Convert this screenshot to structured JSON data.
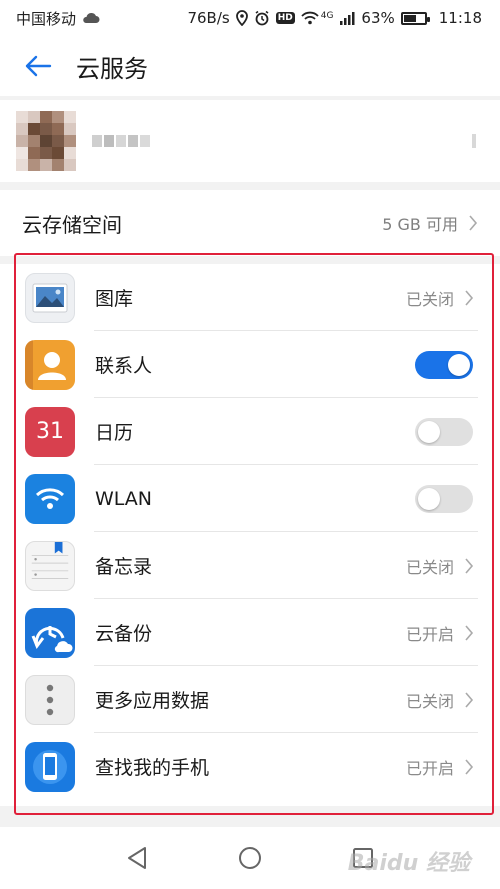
{
  "status_bar": {
    "carrier": "中国移动",
    "speed": "76B/s",
    "hd": "HD",
    "network": "4G",
    "battery": "63%",
    "battery_level": 0.63,
    "time": "11:18"
  },
  "header": {
    "title": "云服务"
  },
  "storage": {
    "label": "云存储空间",
    "value": "5 GB 可用"
  },
  "apps": [
    {
      "label": "图库",
      "icon": "gallery-icon",
      "control": "status",
      "status": "已关闭"
    },
    {
      "label": "联系人",
      "icon": "contacts-icon",
      "control": "toggle",
      "on": true
    },
    {
      "label": "日历",
      "icon": "calendar-icon",
      "icon_text": "31",
      "control": "toggle",
      "on": false
    },
    {
      "label": "WLAN",
      "icon": "wifi-icon",
      "control": "toggle",
      "on": false
    },
    {
      "label": "备忘录",
      "icon": "notepad-icon",
      "control": "status",
      "status": "已关闭"
    },
    {
      "label": "云备份",
      "icon": "cloud-backup-icon",
      "control": "status",
      "status": "已开启"
    },
    {
      "label": "更多应用数据",
      "icon": "more-icon",
      "control": "status",
      "status": "已关闭"
    },
    {
      "label": "查找我的手机",
      "icon": "find-phone-icon",
      "control": "status",
      "status": "已开启"
    }
  ],
  "colors": {
    "accent": "#1a73e8",
    "highlight": "#e0203a"
  },
  "watermark": "Baidu 经验"
}
